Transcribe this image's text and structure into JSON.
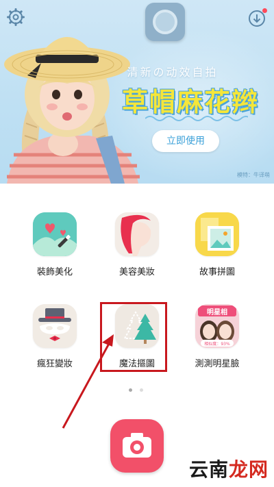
{
  "banner": {
    "subtitle": "清新の动效自拍",
    "title": "草帽麻花辫",
    "cta_label": "立即使用",
    "credit": "模特：牛译萌"
  },
  "icons": {
    "settings": "gear-icon",
    "download": "download-icon",
    "app_logo": "app-logo-icon",
    "camera": "camera-icon"
  },
  "features": [
    {
      "label": "裝飾美化",
      "icon": "decorate-icon"
    },
    {
      "label": "美容美妝",
      "icon": "beauty-icon"
    },
    {
      "label": "故事拼圖",
      "icon": "collage-icon"
    },
    {
      "label": "瘋狂變妝",
      "icon": "crazy-makeup-icon"
    },
    {
      "label": "魔法摳圖",
      "icon": "magic-cutout-icon"
    },
    {
      "label": "測測明星臉",
      "icon": "star-face-icon"
    }
  ],
  "star_face_badge": {
    "title": "明星相",
    "similarity": "相似度：93%"
  },
  "pager": {
    "page": 1,
    "total": 2
  },
  "watermark": {
    "part_a": "云南",
    "part_b": "龙网"
  },
  "colors": {
    "accent": "#f25069",
    "highlight": "#c8181e",
    "banner_title": "#f5e63a"
  }
}
